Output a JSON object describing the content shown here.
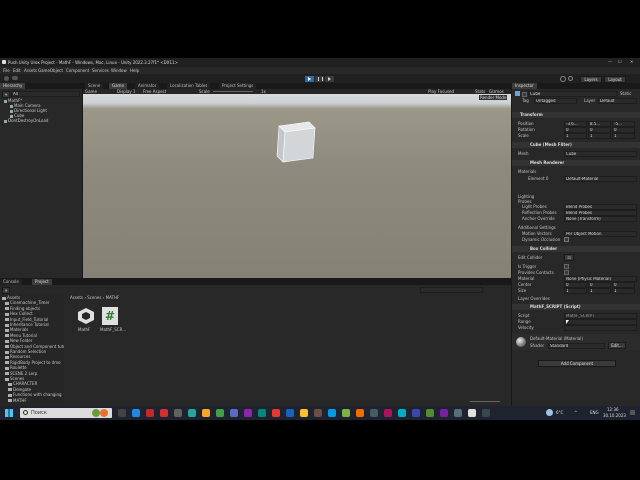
{
  "window": {
    "title": "Push Unity Uroк Project - MathF - Windows, Mac, Linux - Unity 2022.3.27f1* <DX11>"
  },
  "menu": [
    "File",
    "Edit",
    "Assets",
    "GameObject",
    "Component",
    "Services",
    "Window",
    "Help"
  ],
  "toolbar": {
    "layers": "Layers",
    "layout": "Layout"
  },
  "hierarchy": {
    "tab": "Hierarchy",
    "search_placeholder": "All",
    "items": [
      {
        "label": "MathF*",
        "indent": 0
      },
      {
        "label": "Main Camera",
        "indent": 1
      },
      {
        "label": "Directional Light",
        "indent": 1
      },
      {
        "label": "Cube",
        "indent": 1
      },
      {
        "label": "DontDestroyOnLoad",
        "indent": 0
      }
    ]
  },
  "scene_tabs": [
    "Scene",
    "Game",
    "Animator",
    "Localization Tables",
    "Project Settings"
  ],
  "game_bar": {
    "mode": "Game",
    "display": "Display 1",
    "aspect": "Free Aspect",
    "scale_label": "Scale",
    "scale_value": "1x",
    "play_focused": "Play Focused",
    "stats": "Stats",
    "gizmos": "Gizmos"
  },
  "scene_view": {
    "fps_text": "Render Mode"
  },
  "bottom_tabs": [
    "Console",
    "Project"
  ],
  "project": {
    "breadcrumb": [
      "Assets",
      "Scenes",
      "MATHF"
    ],
    "tree": [
      "Assets",
      "Cinemachine_Timer",
      "Finding objects",
      "Hex Collect",
      "Input_Field_Tutorial",
      "Inheritance Tutorial",
      "Materials",
      "Menu Tutorial",
      "New Folder",
      "Object and Component tutorial",
      "Random Selection",
      "Resources",
      "RigidBody Project to dmo",
      "Roulette",
      "SCENE 2 Lerp",
      "Scenes",
      "CHARACTER",
      "Delegate",
      "Functions with changing",
      "MATHF"
    ],
    "files": [
      {
        "name": "MathF",
        "type": "unity"
      },
      {
        "name": "MathF_SCR...",
        "type": "script"
      }
    ]
  },
  "inspector": {
    "tab": "Inspector",
    "object_name": "Cube",
    "static_label": "Static",
    "tag_label": "Tag",
    "tag_value": "Untagged",
    "layer_label": "Layer",
    "layer_value": "Default",
    "transform": {
      "title": "Transform",
      "position_label": "Position",
      "rotation_label": "Rotation",
      "scale_label": "Scale",
      "position": [
        "-3.6...",
        "8.5...",
        "-5..."
      ],
      "rotation": [
        "0",
        "0",
        "0"
      ],
      "scale": [
        "1",
        "1",
        "1"
      ]
    },
    "mesh_filter": {
      "title": "Cube (Mesh Filter)",
      "mesh_label": "Mesh",
      "mesh_value": "Cube"
    },
    "mesh_renderer": {
      "title": "Mesh Renderer",
      "materials_label": "Materials",
      "element_label": "Element 0",
      "element_value": "Default-Material",
      "lighting_label": "Lighting",
      "probes_label": "Probes",
      "light_probes_label": "Light Probes",
      "light_probes_value": "Blend Probes",
      "reflection_probes_label": "Reflection Probes",
      "reflection_probes_value": "Blend Probes",
      "anchor_label": "Anchor Override",
      "anchor_value": "None (Transform)",
      "additional_label": "Additional Settings",
      "motion_label": "Motion Vectors",
      "motion_value": "Per Object Motion",
      "dynamic_label": "Dynamic Occlusion"
    },
    "box_collider": {
      "title": "Box Collider",
      "edit_label": "Edit Collider",
      "trigger_label": "Is Trigger",
      "contacts_label": "Provides Contacts",
      "material_label": "Material",
      "material_value": "None (Physic Material)",
      "center_label": "Center",
      "center": [
        "0",
        "0",
        "0"
      ],
      "size_label": "Size",
      "size": [
        "1",
        "1",
        "1"
      ],
      "layer_overrides": "Layer Overrides"
    },
    "script": {
      "title": "MathF_SCRIPT (Script)",
      "script_label": "Script",
      "script_value": "MathF_SCRIPT",
      "range_label": "Range",
      "velocity_label": "Velocity"
    },
    "material": {
      "title": "Default-Material (Material)",
      "shader_label": "Shader",
      "shader_value": "Standard",
      "edit_label": "Edit..."
    },
    "add_component": "Add Component"
  },
  "taskbar": {
    "search_placeholder": "Поиск",
    "temperature": "6°C",
    "language": "ENG",
    "time": "12:36",
    "date": "30.10.2023"
  }
}
